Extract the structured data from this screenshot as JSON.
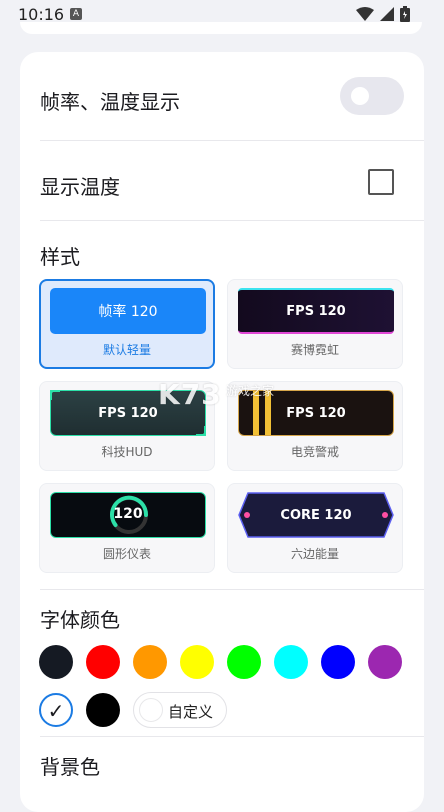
{
  "status_bar": {
    "time": "10:16",
    "badge": "A",
    "icons": [
      "wifi-icon",
      "signal-icon",
      "battery-icon"
    ]
  },
  "settings": {
    "fps_temp_display": {
      "label": "帧率、温度显示",
      "enabled": false
    },
    "show_temperature": {
      "label": "显示温度",
      "checked": false
    }
  },
  "style_section": {
    "title": "样式",
    "options": [
      {
        "preview_text": "帧率 120",
        "caption": "默认轻量",
        "selected": true
      },
      {
        "preview_text": "FPS 120",
        "caption": "赛博霓虹",
        "selected": false
      },
      {
        "preview_text": "FPS 120",
        "caption": "科技HUD",
        "selected": false
      },
      {
        "preview_text": "FPS 120",
        "caption": "电竞警戒",
        "selected": false
      },
      {
        "preview_text": "120",
        "caption": "圆形仪表",
        "selected": false
      },
      {
        "preview_text": "CORE 120",
        "caption": "六边能量",
        "selected": false
      }
    ]
  },
  "font_color_section": {
    "title": "字体颜色",
    "colors": [
      "#151a23",
      "#ff0000",
      "#ff9800",
      "#ffff00",
      "#00ff00",
      "#00ffff",
      "#0000ff",
      "#9c27b0"
    ],
    "selected_symbol": "✓",
    "extra_colors": [
      "#000000"
    ],
    "custom_label": "自定义"
  },
  "background_section": {
    "title": "背景色"
  },
  "watermark": {
    "text": "K73",
    "sub": "游戏之家"
  }
}
